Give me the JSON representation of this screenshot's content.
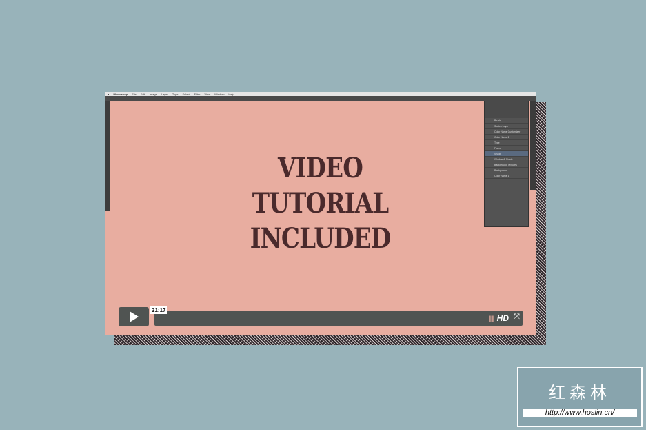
{
  "menu": [
    "Photoshop",
    "File",
    "Edit",
    "Image",
    "Layer",
    "Type",
    "Select",
    "Filter",
    "View",
    "Window",
    "Help"
  ],
  "layers": [
    "Brush",
    "Sketch Layer",
    "Color Name Customizer",
    "Color Name 2",
    "Type",
    "Frame",
    "Shade",
    "Window & Shade",
    "Background Textures",
    "Background",
    "Color Name 1"
  ],
  "title": [
    "VIDEO",
    "TUTORIAL",
    "INCLUDED"
  ],
  "player": {
    "time": "21:17",
    "hd": "HD"
  },
  "watermark": {
    "name": "红森林",
    "url": "http://www.hoslin.cn/"
  }
}
